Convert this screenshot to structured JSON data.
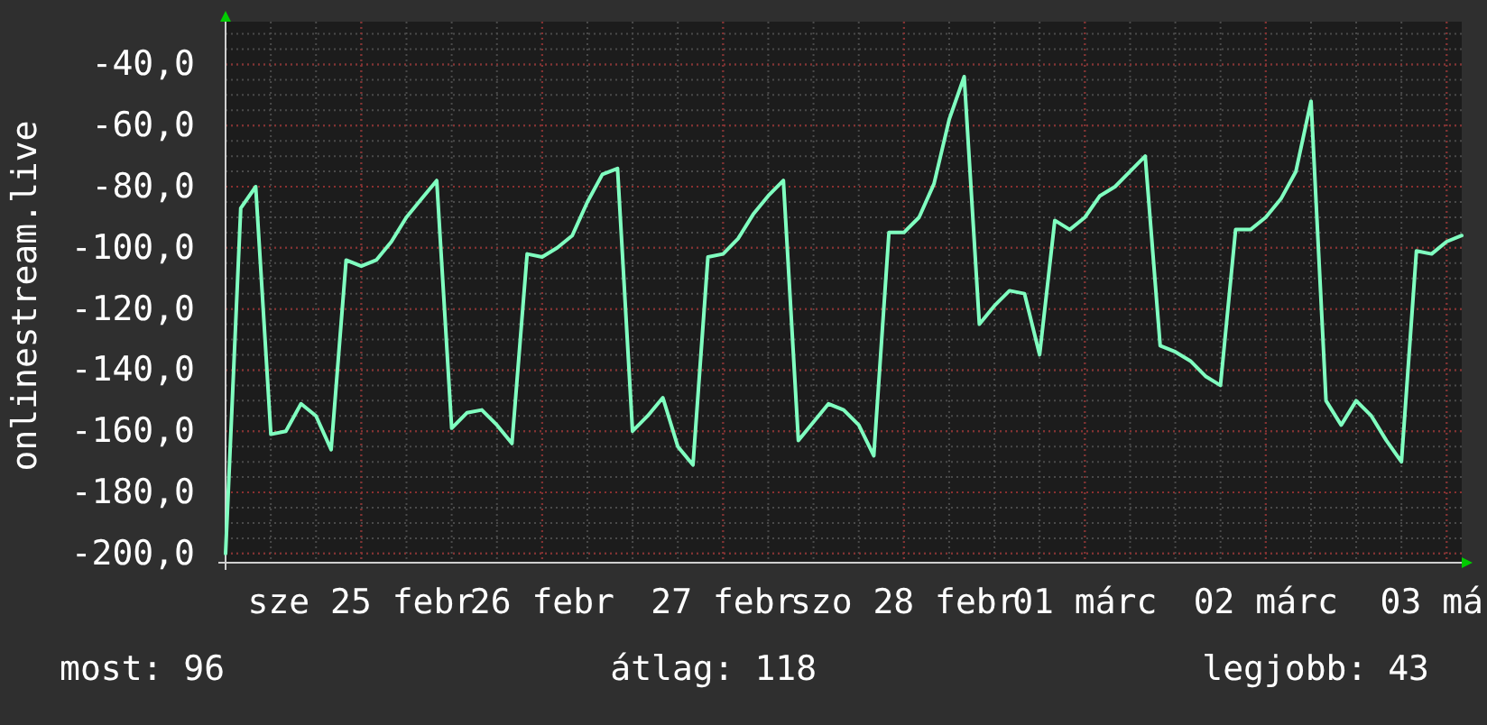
{
  "chart": {
    "chart_data": {
      "type": "line",
      "grid": true,
      "ylabel": "onlinestream.live",
      "ylim": [
        -203,
        -26
      ],
      "yticks": [
        {
          "value": -40,
          "label": "-40,0"
        },
        {
          "value": -60,
          "label": "-60,0"
        },
        {
          "value": -80,
          "label": "-80,0"
        },
        {
          "value": -100,
          "label": "-100,0"
        },
        {
          "value": -120,
          "label": "-120,0"
        },
        {
          "value": -140,
          "label": "-140,0"
        },
        {
          "value": -160,
          "label": "-160,0"
        },
        {
          "value": -180,
          "label": "-180,0"
        },
        {
          "value": -200,
          "label": "-200,0"
        }
      ],
      "categories": [
        null,
        null,
        null,
        null,
        null,
        null,
        null,
        null,
        null,
        "sze 25 febr",
        null,
        null,
        null,
        null,
        null,
        null,
        null,
        null,
        null,
        null,
        null,
        "26 febr",
        null,
        null,
        null,
        null,
        null,
        null,
        null,
        null,
        null,
        null,
        null,
        "27 febr",
        null,
        null,
        null,
        null,
        null,
        null,
        null,
        null,
        null,
        null,
        null,
        "szo 28 febr",
        null,
        null,
        null,
        null,
        null,
        null,
        null,
        null,
        null,
        null,
        null,
        "01 márc",
        null,
        null,
        null,
        null,
        null,
        null,
        null,
        null,
        null,
        null,
        null,
        "02 márc",
        null,
        null,
        null,
        null,
        null,
        null,
        null,
        null,
        null,
        null,
        null,
        "03 má",
        null
      ],
      "series": [
        {
          "color": "#80ffc0",
          "values": [
            -200,
            -87,
            -80,
            -161,
            -160,
            -151,
            -155,
            -166,
            -104,
            -106,
            -104,
            -98,
            -90,
            -84,
            -78,
            -159,
            -154,
            -153,
            -158,
            -164,
            -102,
            -103,
            -100,
            -96,
            -85,
            -76,
            -74,
            -160,
            -155,
            -149,
            -165,
            -171,
            -103,
            -102,
            -97,
            -89,
            -83,
            -78,
            -163,
            -157,
            -151,
            -153,
            -158,
            -168,
            -95,
            -95,
            -90,
            -79,
            -58,
            -44,
            -125,
            -119,
            -114,
            -115,
            -135,
            -91,
            -94,
            -90,
            -83,
            -80,
            -75,
            -70,
            -132,
            -134,
            -137,
            -142,
            -145,
            -94,
            -94,
            -90,
            -84,
            -75,
            -52,
            -150,
            -158,
            -150,
            -155,
            -163,
            -170,
            -101,
            -102,
            -98,
            -96
          ]
        }
      ]
    }
  },
  "stats": [
    "most: 96",
    "átlag: 118",
    "legjobb: 43"
  ]
}
